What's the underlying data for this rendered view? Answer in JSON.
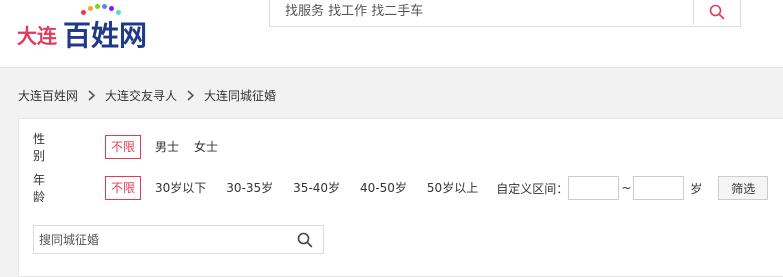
{
  "header": {
    "logo": {
      "city": "大连",
      "brand": "百姓网"
    },
    "search": {
      "placeholder": "找服务 找工作 找二手车"
    },
    "colors": {
      "brand_red": "#e23b5a",
      "brand_blue": "#1f3a8a"
    }
  },
  "breadcrumb": [
    {
      "label": "大连百姓网"
    },
    {
      "label": "大连交友寻人"
    },
    {
      "label": "大连同城征婚"
    }
  ],
  "filters": {
    "gender": {
      "label": "性别",
      "options": [
        {
          "label": "不限",
          "active": true
        },
        {
          "label": "男士",
          "active": false
        },
        {
          "label": "女士",
          "active": false
        }
      ]
    },
    "age": {
      "label": "年龄",
      "options": [
        {
          "label": "不限",
          "active": true
        },
        {
          "label": "30岁以下",
          "active": false
        },
        {
          "label": "30-35岁",
          "active": false
        },
        {
          "label": "35-40岁",
          "active": false
        },
        {
          "label": "40-50岁",
          "active": false
        },
        {
          "label": "50岁以上",
          "active": false
        }
      ],
      "custom_label": "自定义区间：",
      "range_separator": "~",
      "unit": "岁",
      "submit_label": "筛选"
    }
  },
  "local_search": {
    "placeholder": "搜同城征婚"
  },
  "icons": {
    "search": "search-icon",
    "breadcrumb_separator": "chevron-right-icon"
  }
}
